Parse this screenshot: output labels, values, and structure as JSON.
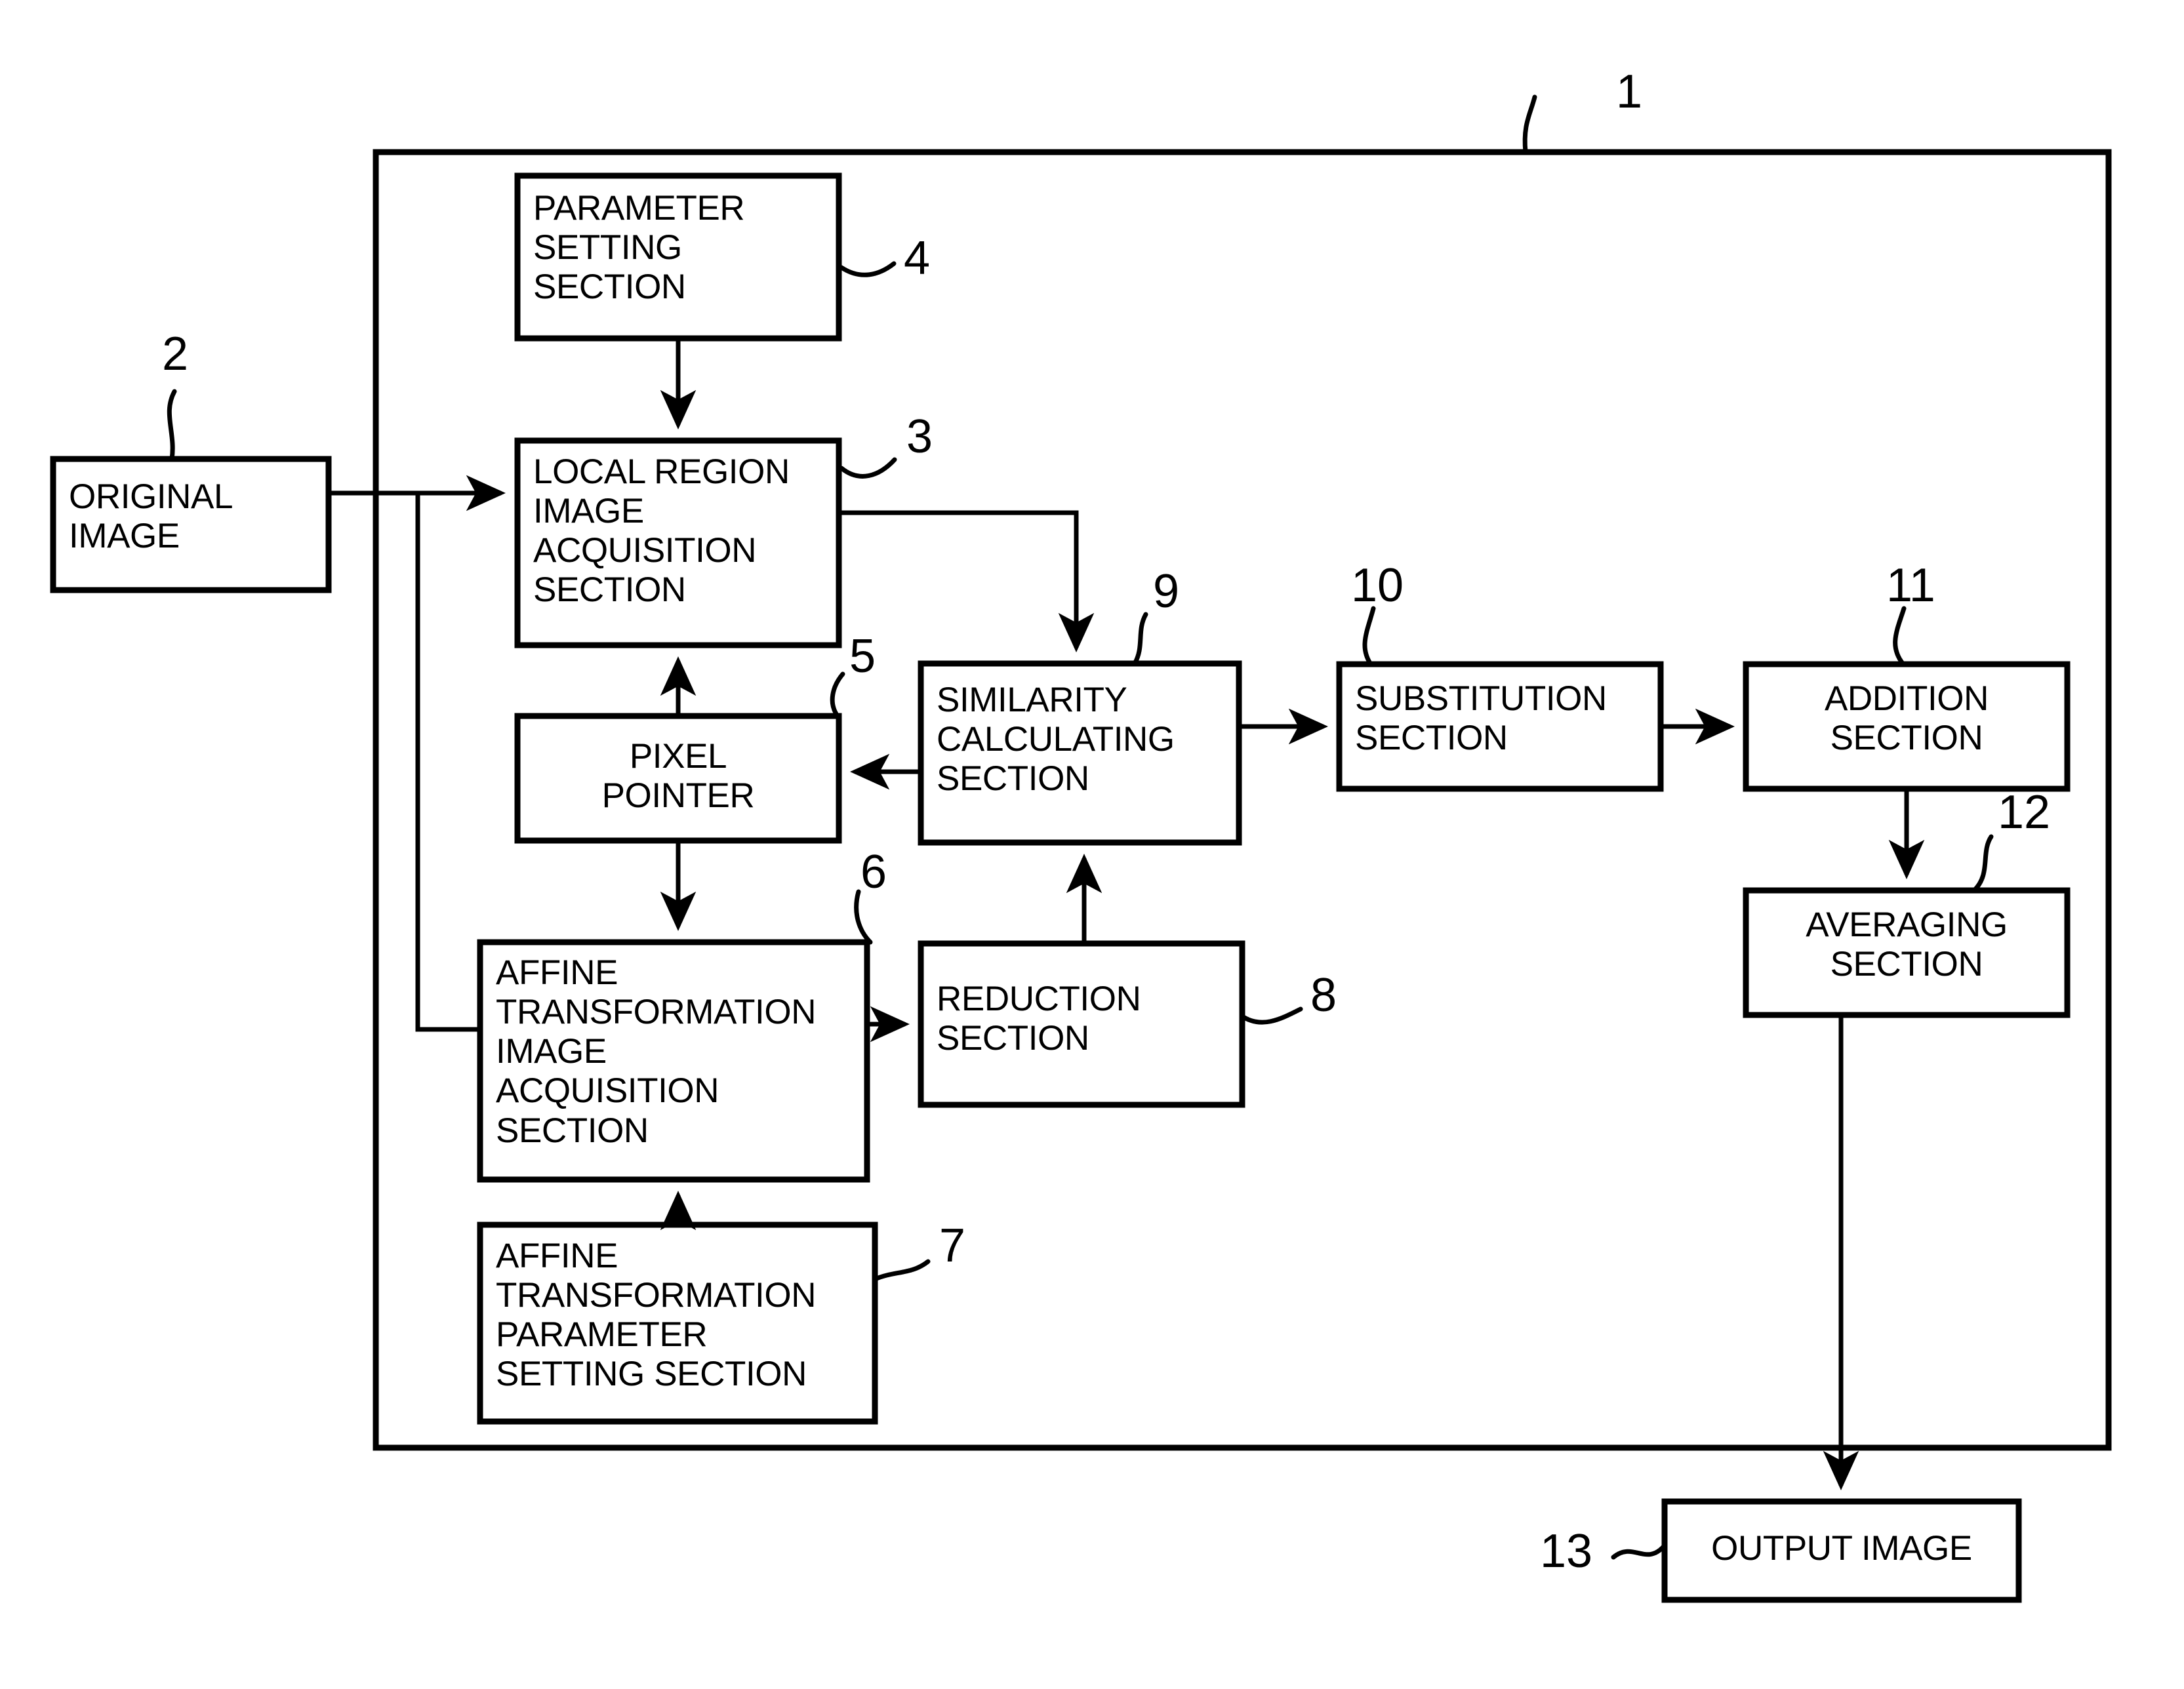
{
  "figure": {
    "type": "patent-block-diagram",
    "background_color": "#ffffff",
    "line_color": "#000000"
  },
  "blocks": {
    "system": {
      "ref": "1",
      "label": ""
    },
    "original_image": {
      "ref": "2",
      "label": "ORIGINAL\nIMAGE"
    },
    "local_region": {
      "ref": "3",
      "label": "LOCAL REGION\nIMAGE\nACQUISITION\nSECTION"
    },
    "parameter_setting": {
      "ref": "4",
      "label": "PARAMETER\nSETTING\nSECTION"
    },
    "pixel_pointer": {
      "ref": "5",
      "label": "PIXEL\nPOINTER"
    },
    "affine_image": {
      "ref": "6",
      "label": "AFFINE\nTRANSFORMATION\nIMAGE\nACQUISITION\nSECTION"
    },
    "affine_param": {
      "ref": "7",
      "label": "AFFINE\nTRANSFORMATION\nPARAMETER\nSETTING SECTION"
    },
    "reduction": {
      "ref": "8",
      "label": "REDUCTION\nSECTION"
    },
    "similarity": {
      "ref": "9",
      "label": "SIMILARITY\nCALCULATING\nSECTION"
    },
    "substitution": {
      "ref": "10",
      "label": "SUBSTITUTION\nSECTION"
    },
    "addition": {
      "ref": "11",
      "label": "ADDITION\nSECTION"
    },
    "averaging": {
      "ref": "12",
      "label": "AVERAGING\nSECTION"
    },
    "output_image": {
      "ref": "13",
      "label": "OUTPUT IMAGE"
    }
  },
  "ref_numbers": [
    "1",
    "2",
    "3",
    "4",
    "5",
    "6",
    "7",
    "8",
    "9",
    "10",
    "11",
    "12",
    "13"
  ]
}
